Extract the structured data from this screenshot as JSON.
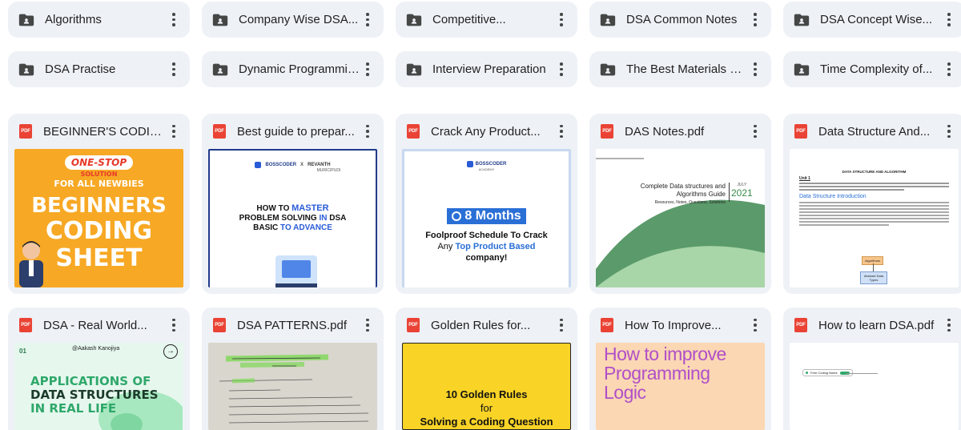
{
  "folders": [
    {
      "label": "Algorithms"
    },
    {
      "label": "Company Wise DSA..."
    },
    {
      "label": "Competitive..."
    },
    {
      "label": "DSA Common Notes"
    },
    {
      "label": "DSA Concept Wise..."
    },
    {
      "label": "DSA Practise"
    },
    {
      "label": "Dynamic Programming"
    },
    {
      "label": "Interview Preparation"
    },
    {
      "label": "The Best Materials O..."
    },
    {
      "label": "Time Complexity of..."
    }
  ],
  "files": [
    {
      "label": "BEGINNER'S CODING..."
    },
    {
      "label": "Best guide to prepar..."
    },
    {
      "label": "Crack Any Product..."
    },
    {
      "label": "DAS Notes.pdf"
    },
    {
      "label": "Data Structure And..."
    },
    {
      "label": "DSA - Real World..."
    },
    {
      "label": "DSA PATTERNS.pdf"
    },
    {
      "label": "Golden Rules for..."
    },
    {
      "label": "How To Improve..."
    },
    {
      "label": "How to learn DSA.pdf"
    }
  ],
  "pdf_badge": "PDF",
  "colors": {
    "tile_bg": "#eef1f6",
    "pdf_red": "#ea4335",
    "icon_gray": "#444746"
  },
  "thumbs": {
    "beginners": {
      "line1": "ONE-STOP",
      "line2": "SOLUTION",
      "line3": "FOR ALL NEWBIES",
      "line4": "BEGINNERS",
      "line5": "CODING",
      "line6": "SHEET"
    },
    "master": {
      "brand": "BOSSCODER",
      "brand_sub": "ACADEMY",
      "x": "X",
      "partner1": "REVANTH",
      "partner2": "MURICIPUDI",
      "l1a": "HOW TO ",
      "l1b": "MASTER",
      "l2a": "PROBLEM SOLVING ",
      "l2b": "IN",
      "l2c": " DSA",
      "l3a": "BASIC ",
      "l3b": "TO",
      "l3c": " ADVANCE"
    },
    "months": {
      "brand": "BOSSCODER",
      "brand_sub": "ACADEMY",
      "badge": "8 Months",
      "l1": "Foolproof Schedule To Crack",
      "l2a": "Any ",
      "l2b": "Top Product Based",
      "l3": "company!"
    },
    "das": {
      "title1": "Complete Data structures and",
      "title2": "Algorithms Guide",
      "sub": "Resources, Notes, Questions, Solutions",
      "month": "JULY",
      "year": "2021"
    },
    "ds": {
      "heading": "DATA STRUCTURE AND ALGORITHM",
      "unit": "Unit 1",
      "section": "Data Structure Introduction",
      "node1": "Algorithms",
      "node2": "Abstract Data Types"
    },
    "apps": {
      "num": "01",
      "handle": "@Aakash Kanojiya",
      "arrow": "→",
      "l1": "APPLICATIONS OF",
      "l2": "DATA STRUCTURES",
      "l3": "IN REAL LIFE"
    },
    "golden": {
      "l1": "10 Golden Rules",
      "l2": "for",
      "l3": "Solving a Coding Question"
    },
    "improve": {
      "l1": "How to improve",
      "l2": "Programming",
      "l3": "Logic"
    },
    "learn": {
      "chip": "Free Coding Notes"
    }
  }
}
